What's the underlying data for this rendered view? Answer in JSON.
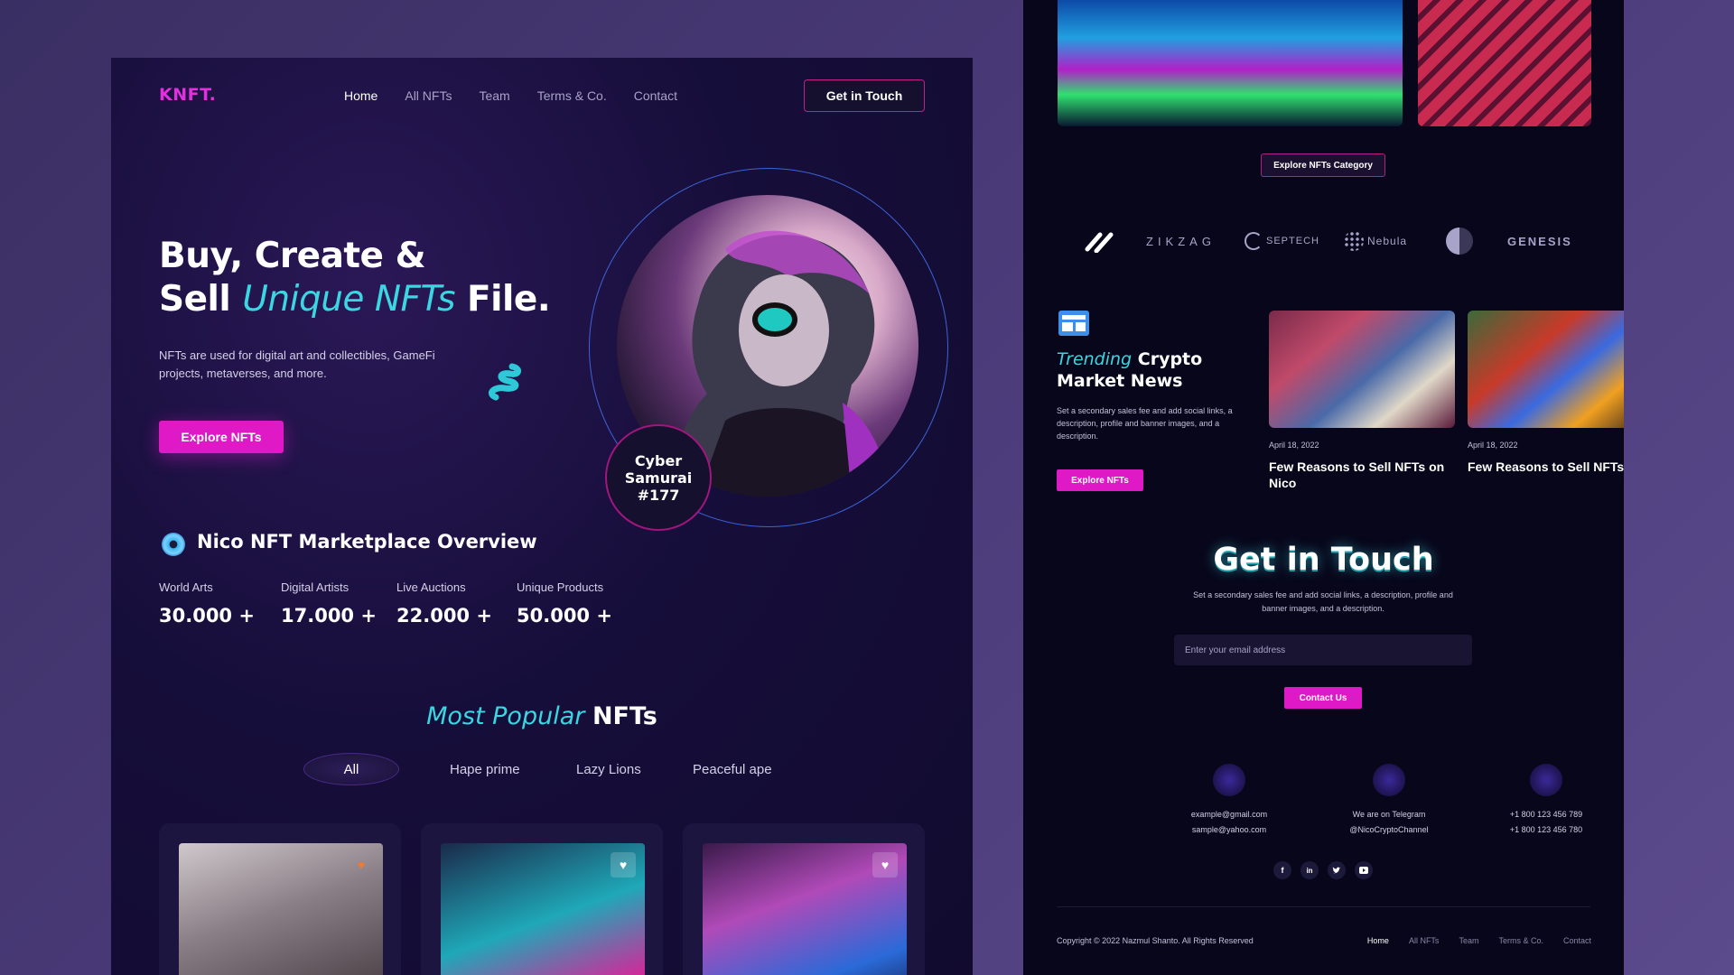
{
  "left": {
    "logo": "KNFT.",
    "nav": [
      "Home",
      "All NFTs",
      "Team",
      "Terms & Co.",
      "Contact"
    ],
    "nav_active": "Home",
    "cta_button": "Get in Touch",
    "hero": {
      "line1": "Buy, Create &",
      "line2_a": "Sell ",
      "line2_italic": "Unique NFTs",
      "line2_b": " File.",
      "description": "NFTs are used for digital art and collectibles, GameFi projects, metaverses, and more.",
      "button": "Explore NFTs",
      "badge": "Cyber\nSamurai\n#177"
    },
    "overview": {
      "title": "Nico NFT Marketplace Overview",
      "stats": [
        {
          "label": "World Arts",
          "value": "30.000 +"
        },
        {
          "label": "Digital Artists",
          "value": "17.000 +"
        },
        {
          "label": "Live Auctions",
          "value": "22.000 +"
        },
        {
          "label": "Unique Products",
          "value": "50.000 +"
        }
      ]
    },
    "popular": {
      "title_italic": "Most Popular",
      "title_bold": "NFTs",
      "tabs": [
        "All",
        "Hape prime",
        "Lazy Lions",
        "Peaceful ape"
      ],
      "active_tab": "All"
    }
  },
  "right": {
    "category_button": "Explore NFTs Category",
    "brands": [
      "ZIKZAG",
      "SEPTECH",
      "Nebula",
      "GENESIS"
    ],
    "news": {
      "title_italic": "Trending",
      "title_bold": "Crypto",
      "title_line2": "Market News",
      "description": "Set a secondary sales fee and add social links, a description, profile and banner images, and a description.",
      "button": "Explore NFTs",
      "articles": [
        {
          "date": "April 18, 2022",
          "title": "Few Reasons to Sell NFTs on Nico"
        },
        {
          "date": "April 18, 2022",
          "title": "Few Reasons to Sell NFTs on Nico"
        }
      ]
    },
    "contact": {
      "title": "Get in Touch",
      "description": "Set a secondary sales fee and add social links, a description, profile and banner images, and a description.",
      "email_placeholder": "Enter your email address",
      "button": "Contact Us",
      "info": [
        {
          "line1": "example@gmail.com",
          "line2": "sample@yahoo.com"
        },
        {
          "line1": "We are on Telegram",
          "line2": "@NicoCryptoChannel"
        },
        {
          "line1": "+1 800 123 456 789",
          "line2": "+1 800 123 456 780"
        }
      ],
      "socials": [
        "f",
        "in",
        "t",
        "yt"
      ]
    },
    "footer": {
      "copyright": "Copyright © 2022 Nazmul Shanto. All Rights Reserved",
      "nav": [
        "Home",
        "All NFTs",
        "Team",
        "Terms & Co.",
        "Contact"
      ],
      "nav_active": "Home"
    }
  },
  "colors": {
    "accent_pink": "#e019c6",
    "accent_cyan": "#3ad7e2",
    "panel_dark": "#120b2f"
  }
}
